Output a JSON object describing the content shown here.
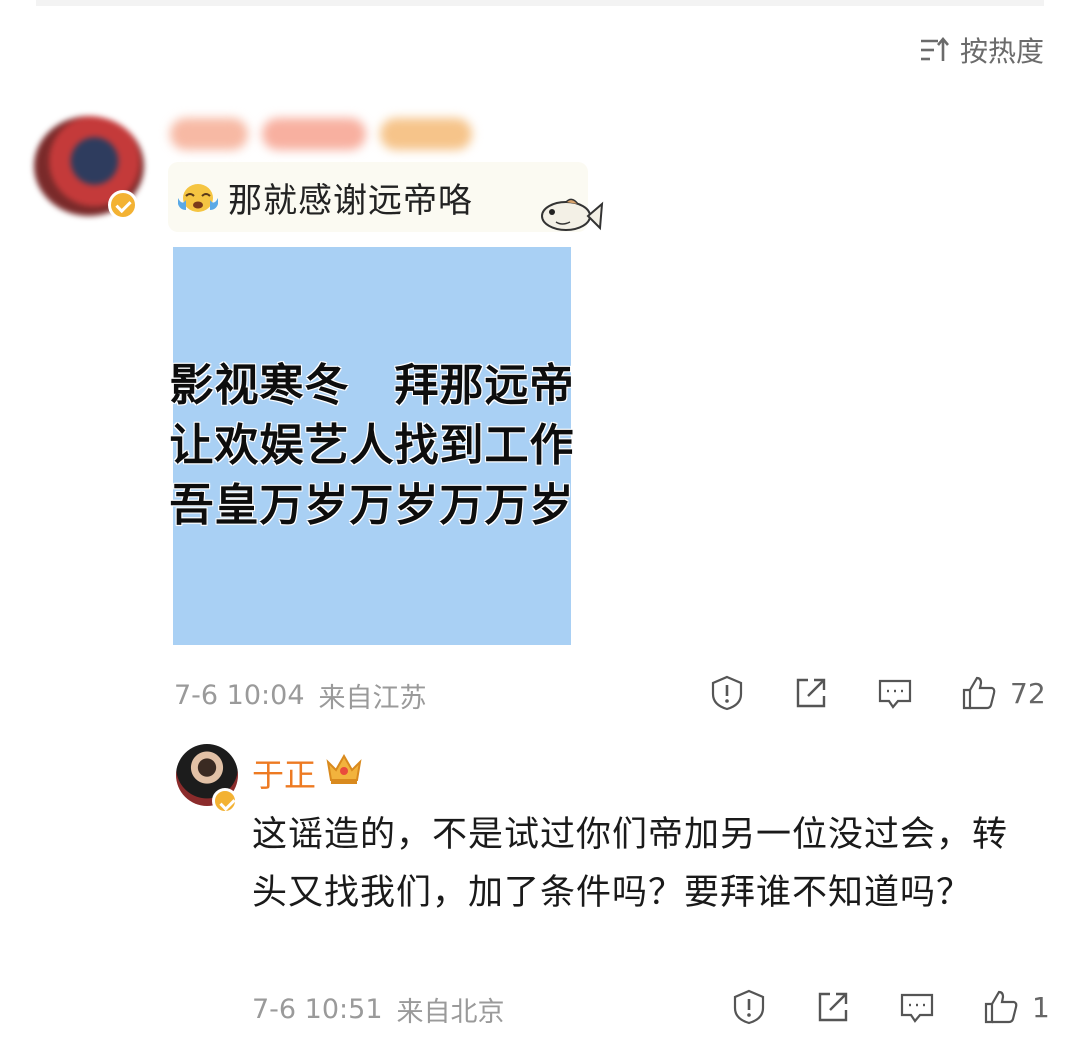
{
  "sort": {
    "label": "按热度",
    "icon": "sort-lines-icon"
  },
  "comment": {
    "avatar": "blurred-user-avatar",
    "text": "那就感谢远帝咯",
    "emoji": "crying-face-emoji",
    "sticker": "fish-sticker",
    "image": {
      "lines": [
        "影视寒冬　拜那远帝",
        "让欢娱艺人找到工作",
        "吾皇万岁万岁万万岁"
      ],
      "background": "#a9d0f4"
    },
    "time": "7-6 10:04",
    "location": "来自江苏",
    "likes": "72",
    "icons": [
      "report-icon",
      "share-icon",
      "comment-icon",
      "like-icon"
    ]
  },
  "reply": {
    "name": "于正",
    "name_color": "#ed7a22",
    "badge": "crown-icon",
    "text": "这谣造的，不是试过你们帝加另一位没过会，转头又找我们，加了条件吗？要拜谁不知道吗？",
    "time": "7-6 10:51",
    "location": "来自北京",
    "likes": "1"
  }
}
